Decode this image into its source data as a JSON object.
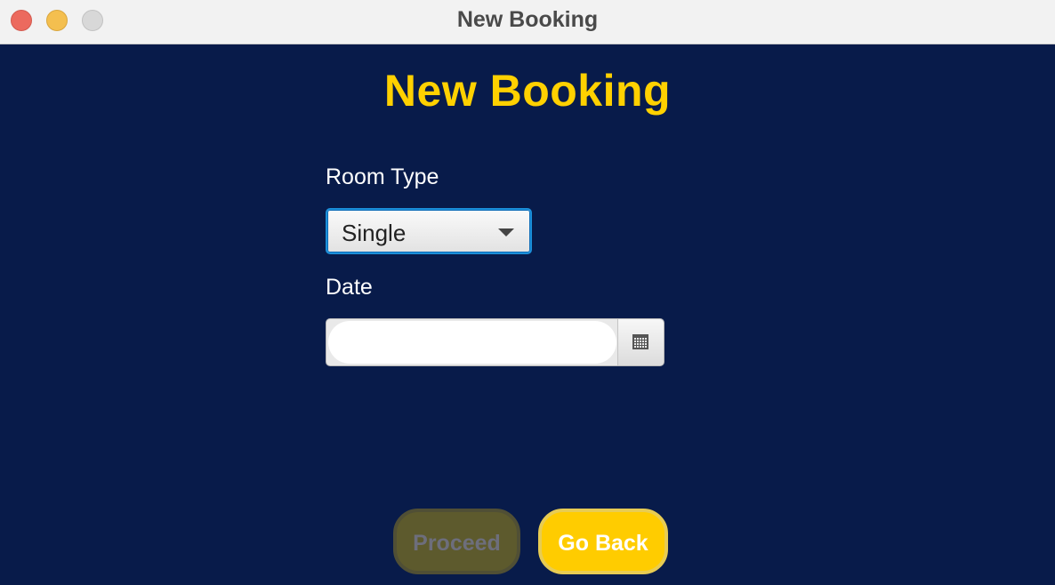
{
  "window": {
    "title": "New Booking"
  },
  "page": {
    "heading": "New Booking"
  },
  "form": {
    "room_type": {
      "label": "Room Type",
      "selected": "Single"
    },
    "date": {
      "label": "Date",
      "value": "",
      "placeholder": ""
    }
  },
  "actions": {
    "proceed_label": "Proceed",
    "go_back_label": "Go Back"
  },
  "colors": {
    "background": "#081b4a",
    "accent": "#ffd100",
    "button_yellow": "#ffcc00",
    "disabled_button": "#5d5a2d"
  },
  "icons": {
    "close": "close-icon",
    "minimize": "minimize-icon",
    "zoom": "zoom-icon",
    "dropdown": "chevron-down-icon",
    "calendar": "calendar-icon"
  }
}
